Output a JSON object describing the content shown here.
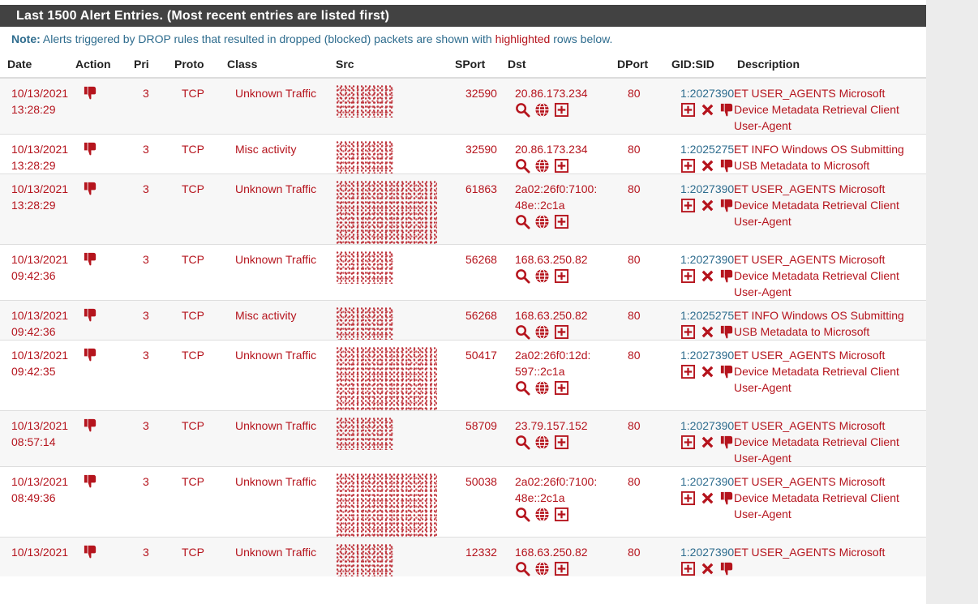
{
  "heading": "Last 1500 Alert Entries. (Most recent entries are listed first)",
  "note": {
    "label": "Note:",
    "text_before": " Alerts triggered by DROP rules that resulted in dropped (blocked) packets are shown with ",
    "highlight": "highlighted",
    "text_after": " rows below."
  },
  "columns": [
    "Date",
    "Action",
    "Pri",
    "Proto",
    "Class",
    "Src",
    "SPort",
    "Dst",
    "DPort",
    "GID:SID",
    "Description"
  ],
  "rows": [
    {
      "date": "10/13/2021",
      "time": "13:28:29",
      "pri": "3",
      "proto": "TCP",
      "class": "Unknown Traffic",
      "sport": "32590",
      "dst1": "20.86.173.234",
      "dst2": "",
      "dport": "80",
      "gid": "1:2027390",
      "desc1": "ET USER_AGENTS Microsoft",
      "desc2": "Device Metadata Retrieval Client",
      "desc3": "User-Agent"
    },
    {
      "date": "10/13/2021",
      "time": "13:28:29",
      "pri": "3",
      "proto": "TCP",
      "class": "Misc activity",
      "sport": "32590",
      "dst1": "20.86.173.234",
      "dst2": "",
      "dport": "80",
      "gid": "1:2025275",
      "desc1": "ET INFO Windows OS Submitting",
      "desc2": "USB Metadata to Microsoft",
      "desc3": ""
    },
    {
      "date": "10/13/2021",
      "time": "13:28:29",
      "pri": "3",
      "proto": "TCP",
      "class": "Unknown Traffic",
      "sport": "61863",
      "dst1": "2a02:26f0:7100:",
      "dst2": "48e::2c1a",
      "dport": "80",
      "gid": "1:2027390",
      "desc1": "ET USER_AGENTS Microsoft",
      "desc2": "Device Metadata Retrieval Client",
      "desc3": "User-Agent"
    },
    {
      "date": "10/13/2021",
      "time": "09:42:36",
      "pri": "3",
      "proto": "TCP",
      "class": "Unknown Traffic",
      "sport": "56268",
      "dst1": "168.63.250.82",
      "dst2": "",
      "dport": "80",
      "gid": "1:2027390",
      "desc1": "ET USER_AGENTS Microsoft",
      "desc2": "Device Metadata Retrieval Client",
      "desc3": "User-Agent"
    },
    {
      "date": "10/13/2021",
      "time": "09:42:36",
      "pri": "3",
      "proto": "TCP",
      "class": "Misc activity",
      "sport": "56268",
      "dst1": "168.63.250.82",
      "dst2": "",
      "dport": "80",
      "gid": "1:2025275",
      "desc1": "ET INFO Windows OS Submitting",
      "desc2": "USB Metadata to Microsoft",
      "desc3": ""
    },
    {
      "date": "10/13/2021",
      "time": "09:42:35",
      "pri": "3",
      "proto": "TCP",
      "class": "Unknown Traffic",
      "sport": "50417",
      "dst1": "2a02:26f0:12d:",
      "dst2": "597::2c1a",
      "dport": "80",
      "gid": "1:2027390",
      "desc1": "ET USER_AGENTS Microsoft",
      "desc2": "Device Metadata Retrieval Client",
      "desc3": "User-Agent"
    },
    {
      "date": "10/13/2021",
      "time": "08:57:14",
      "pri": "3",
      "proto": "TCP",
      "class": "Unknown Traffic",
      "sport": "58709",
      "dst1": "23.79.157.152",
      "dst2": "",
      "dport": "80",
      "gid": "1:2027390",
      "desc1": "ET USER_AGENTS Microsoft",
      "desc2": "Device Metadata Retrieval Client",
      "desc3": "User-Agent"
    },
    {
      "date": "10/13/2021",
      "time": "08:49:36",
      "pri": "3",
      "proto": "TCP",
      "class": "Unknown Traffic",
      "sport": "50038",
      "dst1": "2a02:26f0:7100:",
      "dst2": "48e::2c1a",
      "dport": "80",
      "gid": "1:2027390",
      "desc1": "ET USER_AGENTS Microsoft",
      "desc2": "Device Metadata Retrieval Client",
      "desc3": "User-Agent"
    },
    {
      "date": "10/13/2021",
      "time": "",
      "pri": "3",
      "proto": "TCP",
      "class": "Unknown Traffic",
      "sport": "12332",
      "dst1": "168.63.250.82",
      "dst2": "",
      "dport": "80",
      "gid": "1:2027390",
      "desc1": "ET USER_AGENTS Microsoft",
      "desc2": "",
      "desc3": ""
    }
  ],
  "icons": {
    "action": "thumbs-down-icon",
    "dst": [
      "search-icon",
      "globe-icon",
      "plus-box-icon"
    ],
    "gid": [
      "plus-box-icon",
      "close-icon",
      "thumbs-down-icon"
    ]
  },
  "colors": {
    "accent": "#b5141d",
    "link": "#2e6c8e",
    "header_bg": "#424242"
  }
}
